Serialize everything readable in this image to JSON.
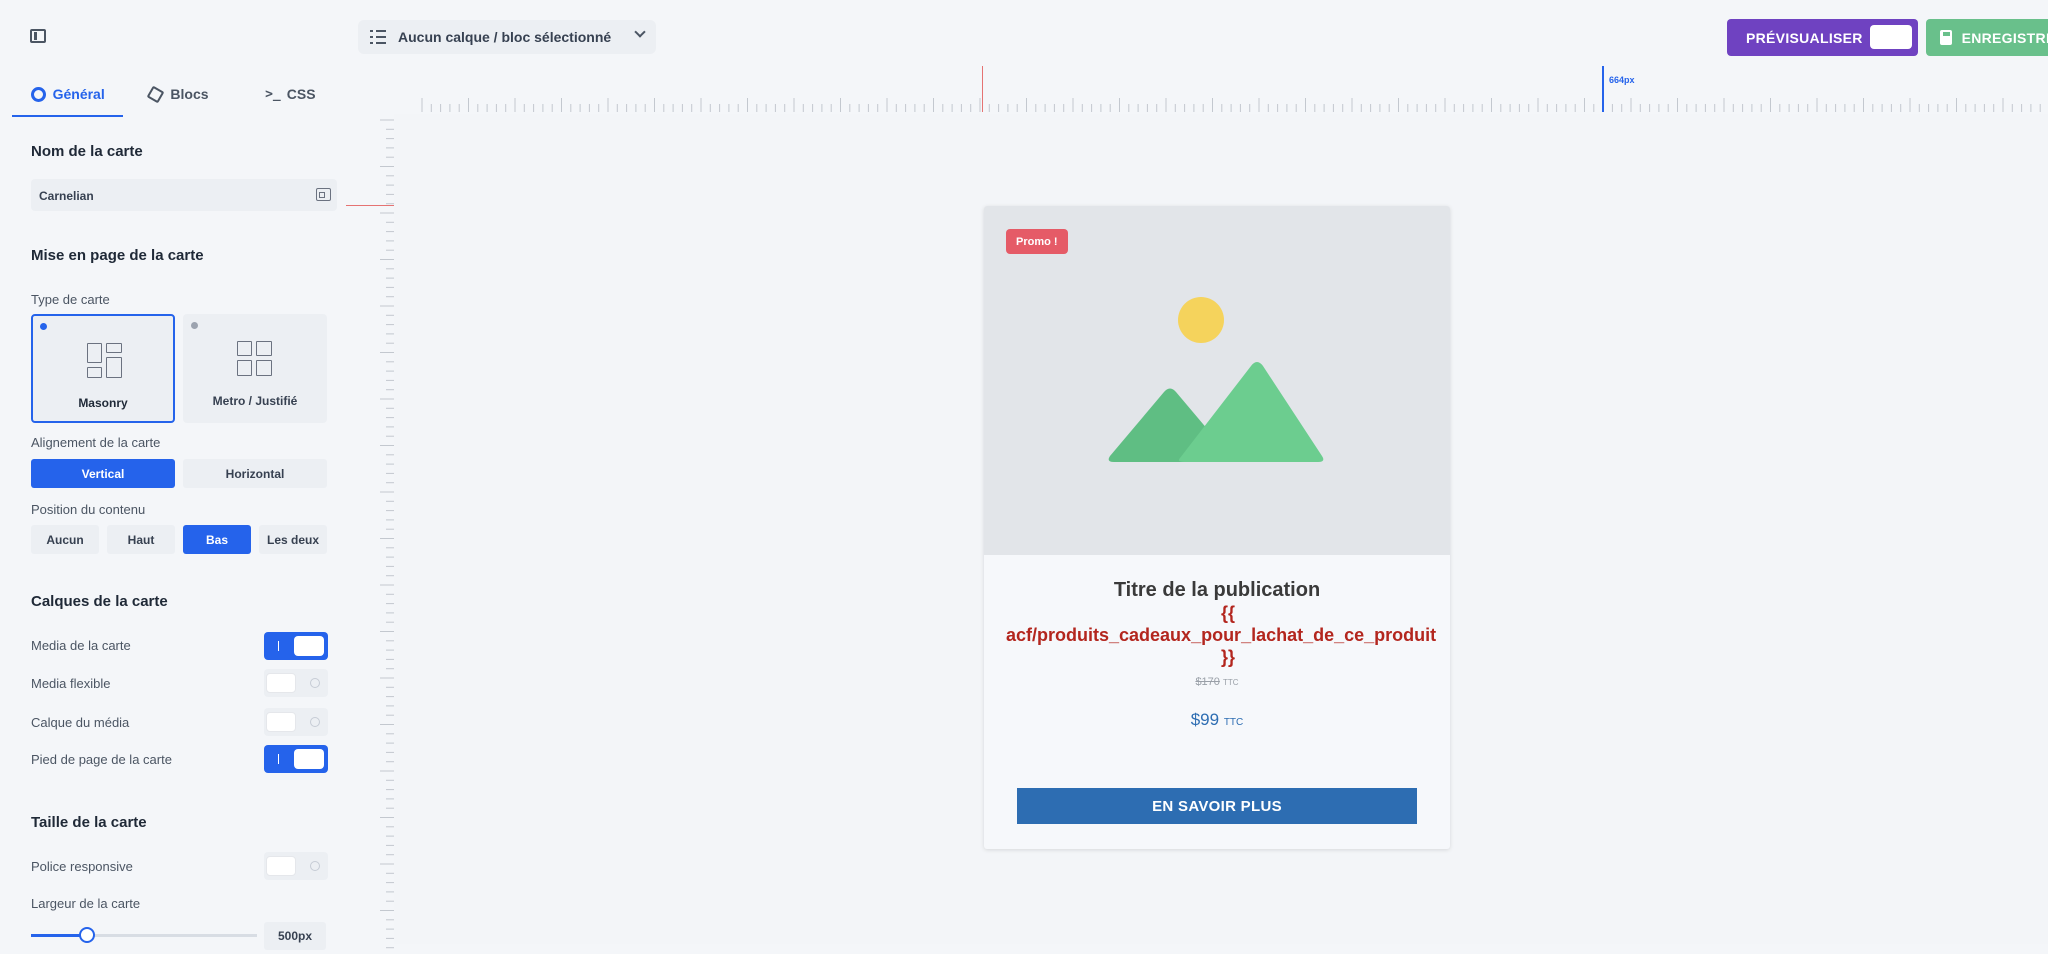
{
  "topbar": {
    "layer_select": "Aucun calque / bloc sélectionné",
    "preview_label": "PRÉVISUALISER",
    "save_label": "ENREGISTRER"
  },
  "tabs": [
    {
      "label": "Général",
      "icon": "gear-icon",
      "active": true
    },
    {
      "label": "Blocs",
      "icon": "cube-icon",
      "active": false
    },
    {
      "label": "CSS",
      "icon": "terminal-icon",
      "active": false
    }
  ],
  "sidebar": {
    "card_name_heading": "Nom de la carte",
    "card_name_value": "Carnelian",
    "layout_heading": "Mise en page de la carte",
    "type_label": "Type de carte",
    "types": [
      {
        "label": "Masonry",
        "selected": true
      },
      {
        "label": "Metro / Justifié",
        "selected": false
      }
    ],
    "alignment_label": "Alignement de la carte",
    "alignments": [
      {
        "label": "Vertical",
        "selected": true
      },
      {
        "label": "Horizontal",
        "selected": false
      }
    ],
    "position_label": "Position du contenu",
    "positions": [
      {
        "label": "Aucun",
        "selected": false
      },
      {
        "label": "Haut",
        "selected": false
      },
      {
        "label": "Bas",
        "selected": true
      },
      {
        "label": "Les deux",
        "selected": false
      }
    ],
    "layers_heading": "Calques de la carte",
    "layers": [
      {
        "label": "Media de la carte",
        "on": true
      },
      {
        "label": "Media flexible",
        "on": false
      },
      {
        "label": "Calque du média",
        "on": false
      },
      {
        "label": "Pied de page de la carte",
        "on": true
      }
    ],
    "size_heading": "Taille de la carte",
    "responsive_font_label": "Police responsive",
    "responsive_font_on": false,
    "width_label": "Largeur de la carte",
    "width_value": "500px",
    "width_fraction": 0.18
  },
  "ruler": {
    "readout": "664px"
  },
  "card": {
    "badge": "Promo !",
    "title": "Titre de la publication",
    "acf_open": "{{",
    "acf_field": "acf/produits_cadeaux_pour_lachat_de_ce_produit",
    "acf_close": "}}",
    "price_old": "$170",
    "price_old_suffix": "TTC",
    "price_new": "$99",
    "price_new_suffix": "TTC",
    "cta": "EN SAVOIR PLUS"
  },
  "colors": {
    "accent": "#2563eb",
    "preview": "#6f42c1",
    "save": "#69c08b",
    "promo": "#e55b67",
    "cta": "#2d6db2",
    "acf": "#b3261e"
  }
}
